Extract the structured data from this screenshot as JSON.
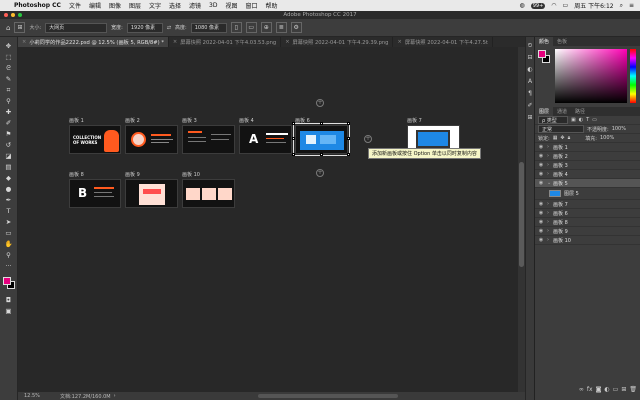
{
  "menubar": {
    "app": "Photoshop CC",
    "items": [
      "文件",
      "编辑",
      "图像",
      "图层",
      "文字",
      "选择",
      "滤镜",
      "3D",
      "视图",
      "窗口",
      "帮助"
    ],
    "battery_badge": "99+",
    "clock": "周五 下午6:12"
  },
  "titlebar": {
    "title": "Adobe Photoshop CC 2017"
  },
  "options": {
    "tool_dropdown": "大网页",
    "width_label": "宽度:",
    "width_value": "1920 像素",
    "height_label": "高度:",
    "height_value": "1080 像素"
  },
  "tabs": [
    {
      "label": "小莉同学的作品2222.psd @ 12.5% (画板 5, RGB/8#) *",
      "active": true
    },
    {
      "label": "屏幕快照 2022-04-01 下午4.03.53.png",
      "active": false
    },
    {
      "label": "屏幕快照 2022-04-01 下午4.29.39.png",
      "active": false
    },
    {
      "label": "屏幕快照 2022-04-01 下午4.27.5t",
      "active": false
    }
  ],
  "artboards": [
    {
      "label": "画板 1",
      "text": "COLLECTION OF WORKS"
    },
    {
      "label": "画板 2",
      "text": ""
    },
    {
      "label": "画板 3",
      "text": ""
    },
    {
      "label": "画板 4",
      "text": "A"
    },
    {
      "label": "画板 6",
      "text": ""
    },
    {
      "label": "画板 7",
      "text": ""
    },
    {
      "label": "画板 8",
      "text": "B"
    },
    {
      "label": "画板 9",
      "text": ""
    },
    {
      "label": "画板 10",
      "text": ""
    }
  ],
  "tooltip": "添加新画板或按住 Option 单击以同时复制内容",
  "status": {
    "zoom": "12.5%",
    "doc": "文档:127.2M/160.0M"
  },
  "color_panel": {
    "tabs": [
      "颜色",
      "色板"
    ],
    "fg": "#e6007e",
    "bg": "#000000"
  },
  "layers_panel": {
    "tabs": [
      "图层",
      "通道",
      "路径"
    ],
    "filter_label": "ρ 类型",
    "blend_mode": "正常",
    "opacity_label": "不透明度:",
    "opacity_value": "100%",
    "lock_label": "锁定:",
    "fill_label": "填充:",
    "fill_value": "100%",
    "layers": [
      {
        "name": "画板 1",
        "selected": false
      },
      {
        "name": "画板 2",
        "selected": false
      },
      {
        "name": "画板 3",
        "selected": false
      },
      {
        "name": "画板 4",
        "selected": false
      },
      {
        "name": "画板 5",
        "selected": true
      },
      {
        "name": "图层 5",
        "selected": false,
        "child": true
      },
      {
        "name": "画板 7",
        "selected": false
      },
      {
        "name": "画板 6",
        "selected": false
      },
      {
        "name": "画板 8",
        "selected": false
      },
      {
        "name": "画板 9",
        "selected": false
      },
      {
        "name": "画板 10",
        "selected": false
      }
    ]
  }
}
